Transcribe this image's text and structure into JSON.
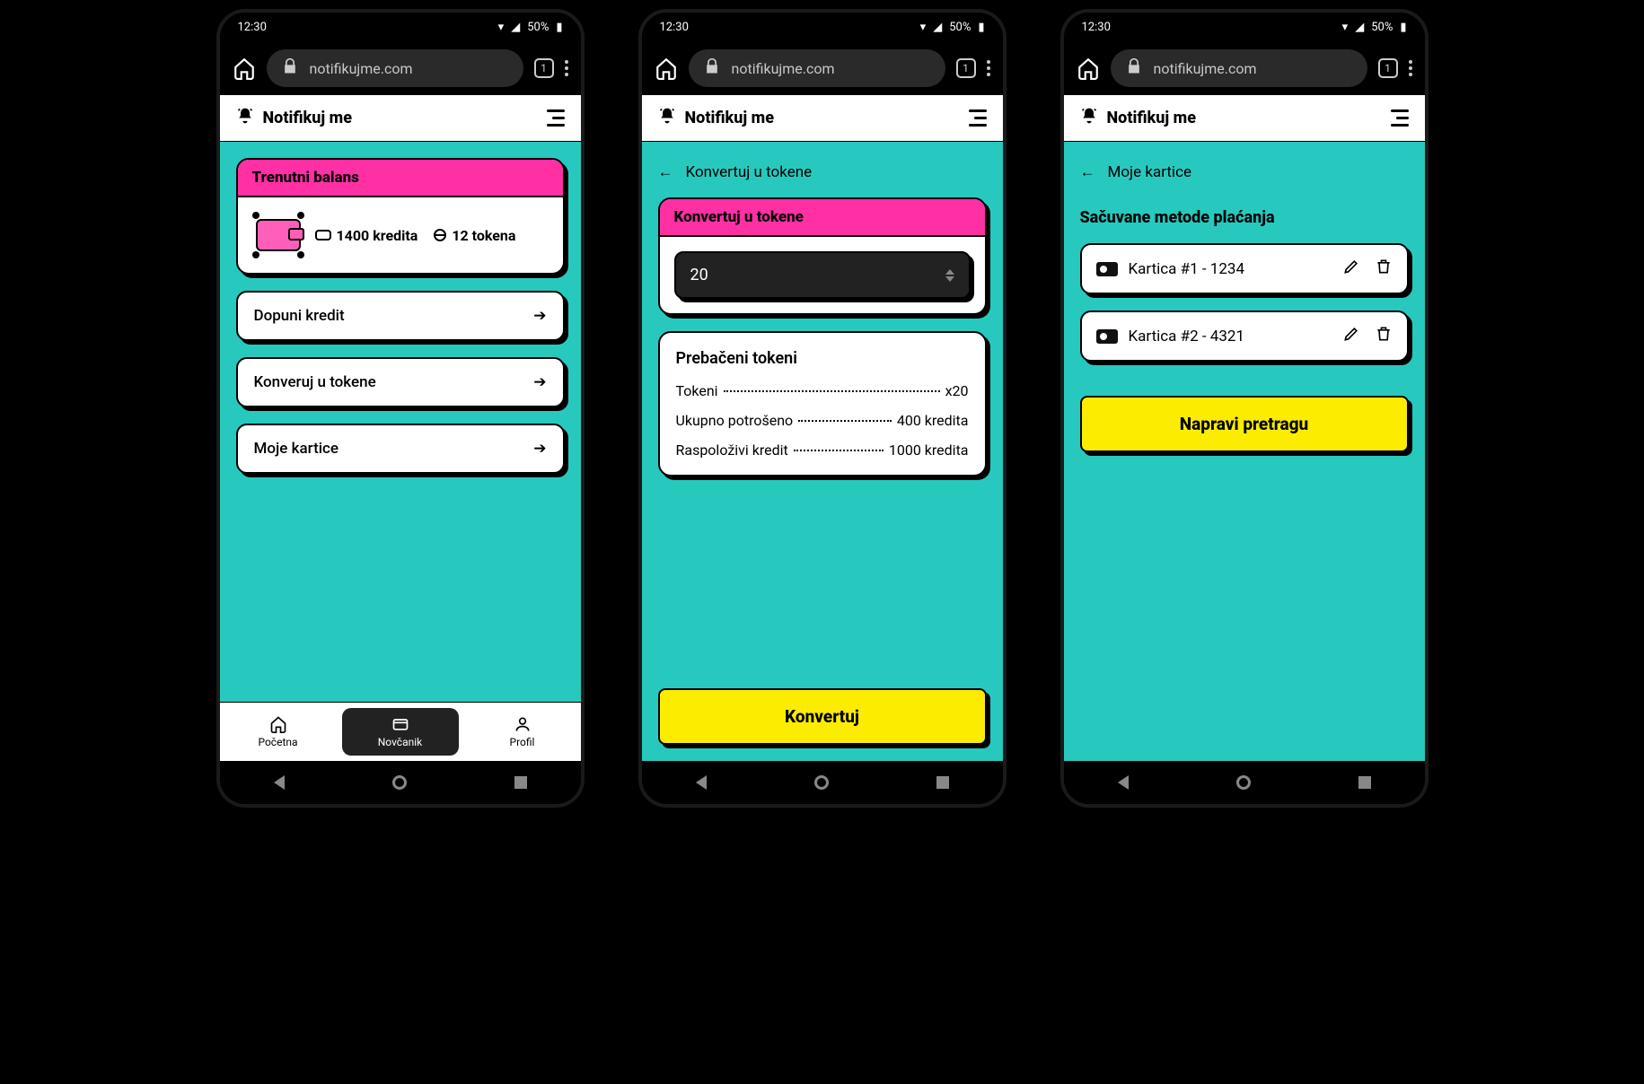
{
  "status": {
    "time": "12:30",
    "battery": "50%"
  },
  "browser": {
    "url": "notifikujme.com",
    "tabs": "1"
  },
  "app": {
    "brand": "Notifikuj me"
  },
  "screen1": {
    "balance": {
      "title": "Trenutni balans",
      "credits_label": "1400 kredita",
      "tokens_label": "12 tokena"
    },
    "actions": {
      "topup": "Dopuni kredit",
      "convert": "Konveruj u tokene",
      "cards": "Moje kartice"
    },
    "nav": {
      "home": "Početna",
      "wallet": "Novčanik",
      "profile": "Profil"
    }
  },
  "screen2": {
    "back": "Konvertuj u tokene",
    "card_title": "Konvertuj u tokene",
    "input_value": "20",
    "summary": {
      "title": "Prebačeni tokeni",
      "rows": [
        {
          "label": "Tokeni",
          "value": "x20"
        },
        {
          "label": "Ukupno potrošeno",
          "value": "400 kredita"
        },
        {
          "label": "Raspoloživi kredit",
          "value": "1000 kredita"
        }
      ]
    },
    "cta": "Konvertuj"
  },
  "screen3": {
    "back": "Moje kartice",
    "section": "Sačuvane metode plaćanja",
    "cards": [
      {
        "name": "Kartica #1 - 1234"
      },
      {
        "name": "Kartica #2 - 4321"
      }
    ],
    "cta": "Napravi pretragu"
  }
}
